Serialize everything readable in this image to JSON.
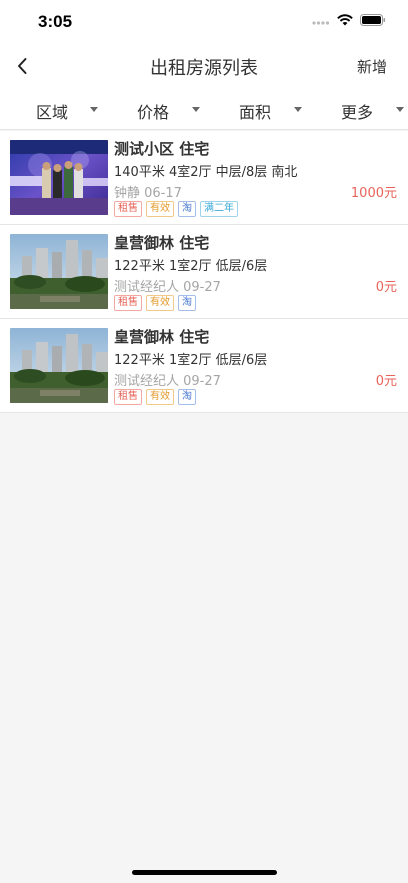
{
  "status_bar": {
    "time": "3:05"
  },
  "nav": {
    "title": "出租房源列表",
    "action_label": "新增"
  },
  "filters": [
    {
      "label": "区域"
    },
    {
      "label": "价格"
    },
    {
      "label": "面积"
    },
    {
      "label": "更多"
    }
  ],
  "listings": [
    {
      "title": "测试小区 住宅",
      "spec": "140平米 4室2厅 中层/8层 南北",
      "meta": "钟静 06-17",
      "price": "1000元",
      "tags": [
        "租售",
        "有效",
        "淘",
        "满二年"
      ]
    },
    {
      "title": "皇营御林 住宅",
      "spec": "122平米 1室2厅 低层/6层",
      "meta": "测试经纪人 09-27",
      "price": "0元",
      "tags": [
        "租售",
        "有效",
        "淘"
      ]
    },
    {
      "title": "皇营御林 住宅",
      "spec": "122平米 1室2厅 低层/6层",
      "meta": "测试经纪人 09-27",
      "price": "0元",
      "tags": [
        "租售",
        "有效",
        "淘"
      ]
    }
  ],
  "colors": {
    "price": "#e8645a",
    "tag_red": "#e8645a",
    "tag_orange": "#e39a2a",
    "tag_blue": "#4a78d2",
    "tag_cyan": "#3aa8d8"
  },
  "icons": [
    "signal-icon",
    "wifi-icon",
    "battery-icon",
    "back-arrow-icon",
    "dropdown-triangle-icon"
  ]
}
